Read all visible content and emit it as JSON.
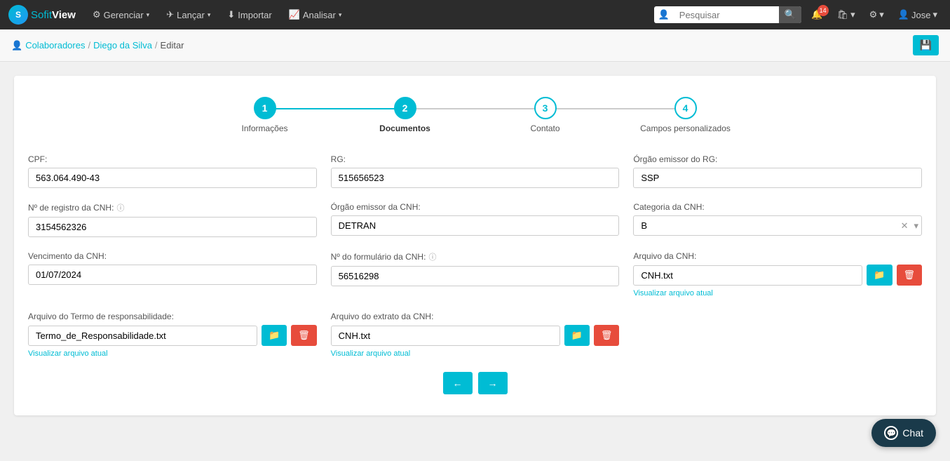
{
  "brand": {
    "logo_text": "S",
    "name_part1": "Sofit",
    "name_part2": "View"
  },
  "navbar": {
    "items": [
      {
        "label": "Gerenciar",
        "icon": "⚙",
        "has_dropdown": true
      },
      {
        "label": "Lançar",
        "icon": "✈",
        "has_dropdown": true
      },
      {
        "label": "Importar",
        "icon": "⬇",
        "has_dropdown": false
      },
      {
        "label": "Analisar",
        "icon": "📈",
        "has_dropdown": true
      }
    ],
    "search_placeholder": "Pesquisar",
    "notification_count": "14",
    "user": "Jose"
  },
  "breadcrumb": {
    "items": [
      {
        "label": "Colaboradores",
        "link": true
      },
      {
        "label": "Diego da Silva",
        "link": true
      },
      {
        "label": "Editar",
        "link": false
      }
    ]
  },
  "stepper": {
    "steps": [
      {
        "number": "1",
        "label": "Informações",
        "state": "completed"
      },
      {
        "number": "2",
        "label": "Documentos",
        "state": "active"
      },
      {
        "number": "3",
        "label": "Contato",
        "state": "inactive"
      },
      {
        "number": "4",
        "label": "Campos personalizados",
        "state": "inactive"
      }
    ]
  },
  "form": {
    "cpf_label": "CPF:",
    "cpf_value": "563.064.490-43",
    "rg_label": "RG:",
    "rg_value": "515656523",
    "orgao_rg_label": "Órgão emissor do RG:",
    "orgao_rg_value": "SSP",
    "cnh_reg_label": "Nº de registro da CNH:",
    "cnh_reg_value": "3154562326",
    "orgao_cnh_label": "Órgão emissor da CNH:",
    "orgao_cnh_value": "DETRAN",
    "categoria_cnh_label": "Categoria da CNH:",
    "categoria_cnh_value": "B",
    "vencimento_label": "Vencimento da CNH:",
    "vencimento_value": "01/07/2024",
    "formulario_cnh_label": "Nº do formulário da CNH:",
    "formulario_cnh_value": "56516298",
    "arquivo_cnh_label": "Arquivo da CNH:",
    "arquivo_cnh_value": "CNH.txt",
    "arquivo_cnh_view": "Visualizar arquivo atual",
    "termo_label": "Arquivo do Termo de responsabilidade:",
    "termo_value": "Termo_de_Responsabilidade.txt",
    "termo_view": "Visualizar arquivo atual",
    "extrato_label": "Arquivo do extrato da CNH:",
    "extrato_value": "CNH.txt",
    "extrato_view": "Visualizar arquivo atual"
  },
  "nav_buttons": {
    "back": "←",
    "next": "→"
  },
  "chat": {
    "label": "Chat"
  }
}
